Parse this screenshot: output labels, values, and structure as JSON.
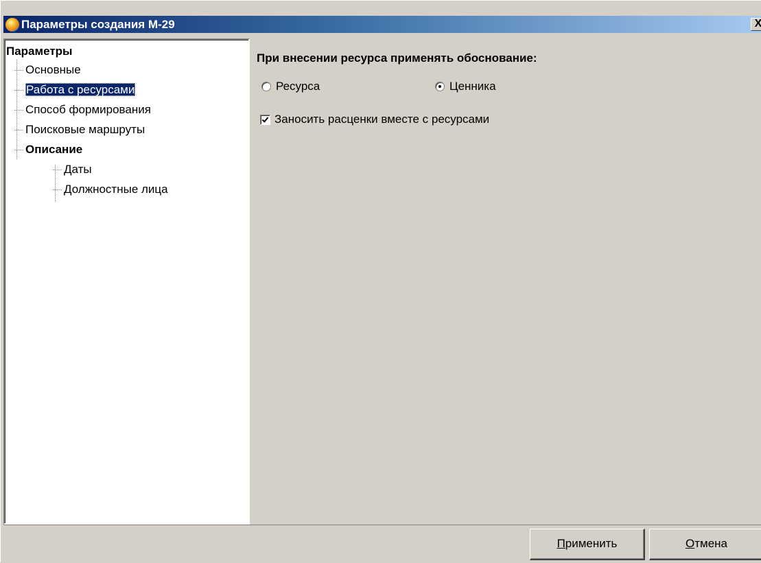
{
  "window": {
    "title": "Параметры создания М-29",
    "close_glyph": "X",
    "icon": "app-icon"
  },
  "tree": {
    "root": "Параметры",
    "items": [
      {
        "label": "Основные",
        "level": 1,
        "selected": false,
        "bold": false
      },
      {
        "label": "Работа с ресурсами",
        "level": 1,
        "selected": true,
        "bold": false
      },
      {
        "label": "Способ формирования",
        "level": 1,
        "selected": false,
        "bold": false
      },
      {
        "label": "Поисковые маршруты",
        "level": 1,
        "selected": false,
        "bold": false
      },
      {
        "label": "Описание",
        "level": 1,
        "selected": false,
        "bold": true
      },
      {
        "label": "Даты",
        "level": 2,
        "selected": false,
        "bold": false
      },
      {
        "label": "Должностные лица",
        "level": 2,
        "selected": false,
        "bold": false
      }
    ]
  },
  "content": {
    "heading": "При внесении ресурса применять обоснование:",
    "radio_resource": {
      "label": "Ресурса",
      "checked": false
    },
    "radio_pricelist": {
      "label": "Ценника",
      "checked": true
    },
    "checkbox_rates": {
      "label": "Заносить расценки вместе с ресурсами",
      "checked": true
    }
  },
  "buttons": {
    "apply_accel": "П",
    "apply_rest": "рименить",
    "cancel_accel": "О",
    "cancel_rest": "тмена"
  },
  "colors": {
    "face": "#d4d0c8",
    "title_start": "#0a246a",
    "title_end": "#a6caf0",
    "selection": "#0a246a"
  }
}
